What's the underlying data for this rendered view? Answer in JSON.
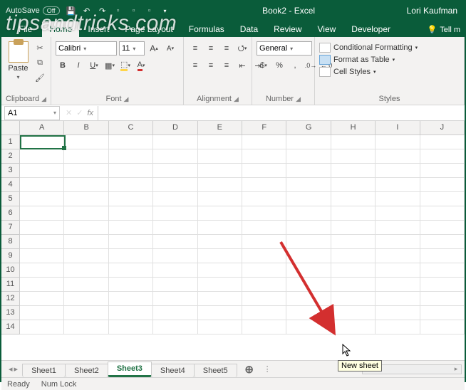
{
  "titlebar": {
    "autosave_label": "AutoSave",
    "autosave_state": "Off",
    "doc_title": "Book2 - Excel",
    "user": "Lori Kaufman"
  },
  "tabs": {
    "file": "File",
    "items": [
      "Home",
      "Insert",
      "Page Layout",
      "Formulas",
      "Data",
      "Review",
      "View",
      "Developer"
    ],
    "active_index": 0,
    "tell_me": "Tell m"
  },
  "ribbon": {
    "clipboard": {
      "paste": "Paste",
      "label": "Clipboard"
    },
    "font": {
      "name": "Calibri",
      "size": "11",
      "label": "Font"
    },
    "alignment": {
      "label": "Alignment"
    },
    "number": {
      "format": "General",
      "label": "Number"
    },
    "styles": {
      "cond": "Conditional Formatting",
      "table": "Format as Table",
      "cell": "Cell Styles",
      "label": "Styles"
    }
  },
  "formula": {
    "namebox": "A1",
    "fx": "fx"
  },
  "grid": {
    "cols": [
      "A",
      "B",
      "C",
      "D",
      "E",
      "F",
      "G",
      "H",
      "I",
      "J"
    ],
    "rows": [
      "1",
      "2",
      "3",
      "4",
      "5",
      "6",
      "7",
      "8",
      "9",
      "10",
      "11",
      "12",
      "13",
      "14"
    ]
  },
  "sheets": {
    "items": [
      "Sheet1",
      "Sheet2",
      "Sheet3",
      "Sheet4",
      "Sheet5"
    ],
    "active_index": 2,
    "new_tooltip": "New sheet"
  },
  "status": {
    "ready": "Ready",
    "numlock": "Num Lock"
  },
  "watermark": "tipsandtricks.com"
}
